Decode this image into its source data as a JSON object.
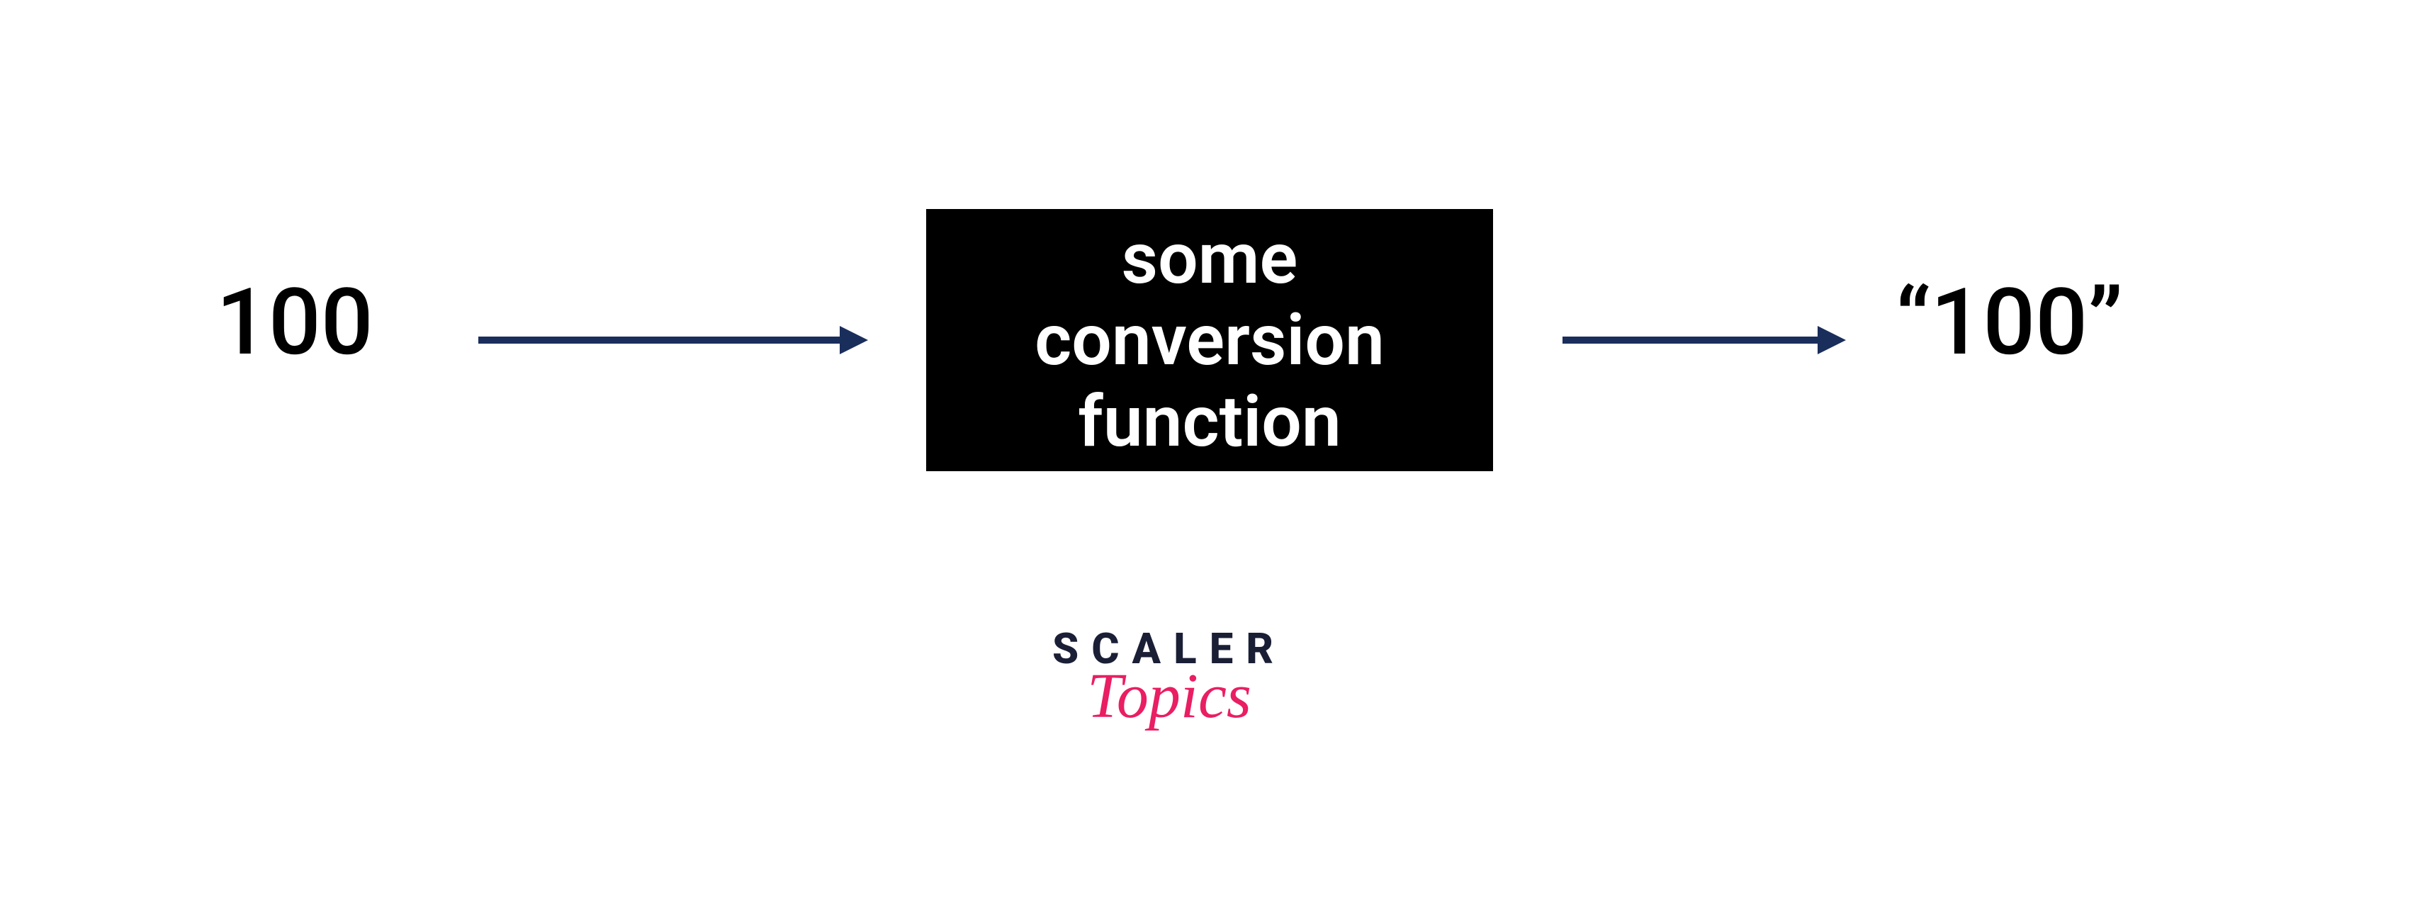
{
  "diagram": {
    "input_value": "100",
    "output_value": "“100”",
    "box": {
      "line1": "some",
      "line2": "conversion",
      "line3": "function"
    },
    "arrow_color": "#1a2e5c"
  },
  "logo": {
    "brand": "SCALER",
    "suffix": "Topics"
  }
}
